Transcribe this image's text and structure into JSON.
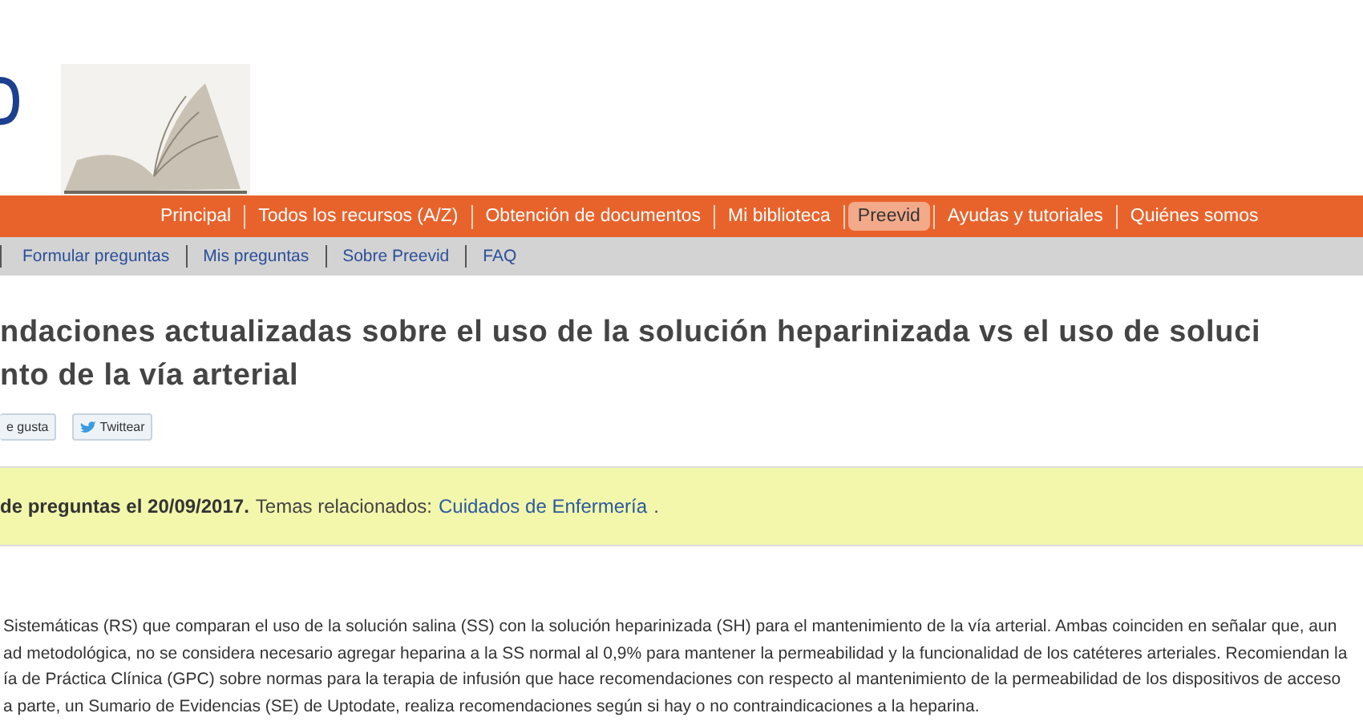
{
  "main_nav": [
    {
      "label": "Principal",
      "selected": false
    },
    {
      "label": "Todos los recursos (A/Z)",
      "selected": false
    },
    {
      "label": "Obtención de documentos",
      "selected": false
    },
    {
      "label": "Mi biblioteca",
      "selected": false
    },
    {
      "label": "Preevid",
      "selected": true
    },
    {
      "label": "Ayudas y tutoriales",
      "selected": false
    },
    {
      "label": "Quiénes somos",
      "selected": false
    }
  ],
  "sub_nav": [
    "Formular preguntas",
    "Mis preguntas",
    "Sobre Preevid",
    "FAQ"
  ],
  "title_lines": [
    "ndaciones actualizadas sobre el uso de la solución heparinizada vs el uso de soluci",
    "nto de la vía arterial"
  ],
  "social": {
    "like": "e gusta",
    "tweet": "Twittear"
  },
  "notice": {
    "bold": "de preguntas el 20/09/2017.",
    "text": "Temas relacionados:",
    "link": "Cuidados de Enfermería",
    "tail": "."
  },
  "body_lines": [
    "Sistemáticas (RS) que comparan el uso de la solución salina (SS) con la solución heparinizada (SH) para el mantenimiento de la vía arterial. Ambas coinciden en señalar que, aun",
    "ad metodológica, no se considera necesario agregar heparina a la SS normal al 0,9% para mantener la permeabilidad y la funcionalidad de los catéteres arteriales. Recomiendan la",
    "ía de Práctica Clínica (GPC) sobre normas para la terapia de infusión que hace recomendaciones con respecto al mantenimiento de la permeabilidad de los dispositivos de acceso",
    "a parte, un Sumario de Evidencias (SE) de Uptodate, realiza recomendaciones según si hay o no contraindicaciones a la heparina."
  ]
}
